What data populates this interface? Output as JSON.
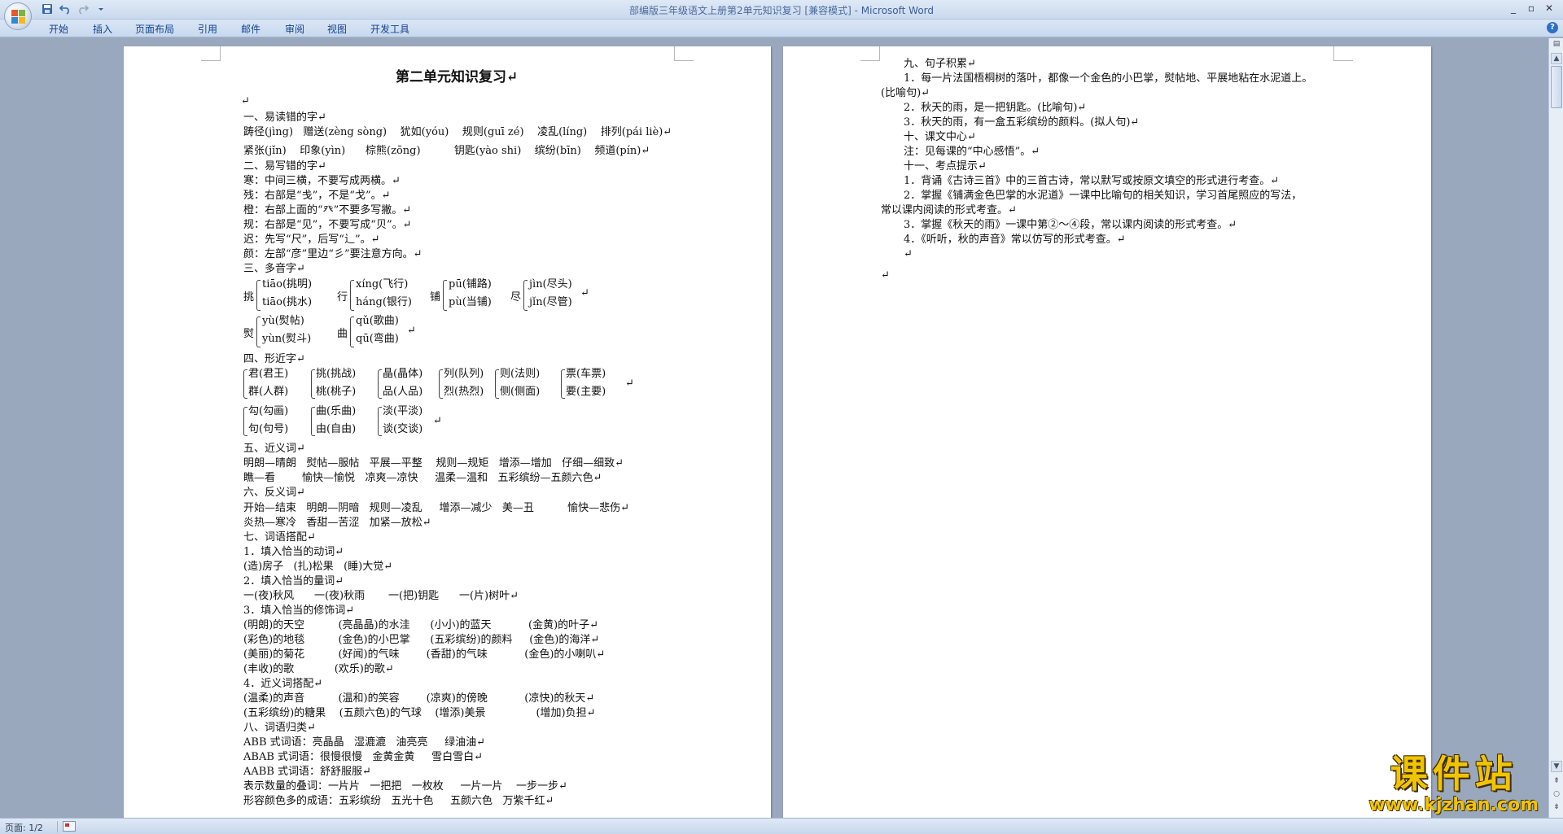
{
  "window": {
    "title": "部编版三年级语文上册第2单元知识复习 [兼容模式]",
    "title_sep": " - ",
    "app_name": "Microsoft Word",
    "minimize": "_",
    "restore": "▫",
    "close": "✕"
  },
  "quick_access": {
    "save_icon": "save-icon",
    "undo_icon": "undo-icon",
    "redo_icon": "redo-icon",
    "customize_icon": "dropdown-icon"
  },
  "ribbon_tabs": [
    "开始",
    "插入",
    "页面布局",
    "引用",
    "邮件",
    "审阅",
    "视图",
    "开发工具"
  ],
  "help": "?",
  "page1": {
    "lines": [
      "第二单元知识复习↵",
      "↵",
      "一、易读错的字↵",
      "踌径(jìng)   赠送(zèng sòng)    犹如(yóu)    规则(guī zé)    凌乱(líng)    排列(pái liè)↵",
      "紧张(jǐn)    印象(yìn)      棕熊(zōng)          钥匙(yào shi)    缤纷(bīn)    频道(pín)↵",
      "二、易写错的字↵",
      "寒：中间三横，不要写成两横。↵",
      "残：右部是“戋”，不是“戈”。↵",
      "橙：右部上面的“癶”不要多写撇。↵",
      "规：右部是“见”，不要写成“贝”。↵",
      "迟：先写“尺”，后写“辶”。↵",
      "颜：左部“彦”里边“彡”要注意方向。↵",
      "三、多音字↵",
      "挑",
      "tiāo(挑明)",
      "tiāo(挑水)",
      "行",
      "xíng(飞行)",
      "háng(银行)",
      "铺",
      "pū(铺路)",
      "pù(当铺)",
      "尽",
      "jìn(尽头)",
      "jǐn(尽管)",
      "↵",
      "熨",
      "yù(熨帖)",
      "yùn(熨斗)",
      "曲",
      "qǔ(歌曲)",
      "qū(弯曲)",
      "↵",
      "四、形近字↵",
      "君(君王)",
      "群(人群)",
      "挑(挑战)",
      "桃(桃子)",
      "晶(晶体)",
      "品(人品)",
      "列(队列)",
      "烈(热烈)",
      "则(法则)",
      "侧(侧面)",
      "票(车票)",
      "要(主要)",
      "↵",
      "勾(勾画)",
      "句(句号)",
      "曲(乐曲)",
      "由(自由)",
      "淡(平淡)",
      "谈(交谈)",
      "↵",
      "五、近义词↵",
      "明朗—晴朗   熨帖—服帖   平展—平整    规则—规矩   增添—增加   仔细—细致↵",
      "瞧—看        愉快—愉悦   凉爽—凉快     温柔—温和   五彩缤纷—五颜六色↵",
      "六、反义词↵",
      "开始—结束   明朗—阴暗   规则—凌乱     增添—减少   美—丑          愉快—悲伤↵",
      "炎热—寒冷   香甜—苦涩   加紧—放松↵",
      "七、词语搭配↵",
      "1．填入恰当的动词↵",
      "(造)房子   (扎)松果   (睡)大觉↵",
      "2．填入恰当的量词↵",
      "一(夜)秋风      一(夜)秋雨       一(把)钥匙      一(片)树叶↵",
      "3．填入恰当的修饰词↵",
      "(明朗)的天空          (亮晶晶)的水洼      (小小)的蓝天           (金黄)的叶子↵",
      "(彩色)的地毯          (金色)的小巴掌      (五彩缤纷)的颜料     (金色)的海洋↵",
      "(美丽)的菊花          (好闻)的气味        (香甜)的气味           (金色)的小喇叭↵",
      "(丰收)的歌            (欢乐)的歌↵",
      "4．近义词搭配↵",
      "(温柔)的声音          (温和)的笑容        (凉爽)的傍晚           (凉快)的秋天↵",
      "(五彩缤纷)的糖果    (五颜六色)的气球    (增添)美景               (增加)负担↵",
      "八、词语归类↵",
      "ABB 式词语：亮晶晶   湿漉漉   油亮亮     绿油油↵",
      "ABAB 式词语：很慢很慢   金黄金黄     雪白雪白↵",
      "AABB 式词语：舒舒服服↵",
      "表示数量的叠词：一片片   一把把   一枚枚     一片一片    一步一步↵",
      "形容颜色多的成语：五彩缤纷   五光十色     五颜六色   万紫千红↵"
    ]
  },
  "page2": {
    "lines": [
      "九、句子积累↵",
      "1．每一片法国梧桐树的落叶，都像一个金色的小巴掌，熨帖地、平展地粘在水泥道上。",
      "(比喻句)↵",
      "2．秋天的雨，是一把钥匙。(比喻句)↵",
      "3．秋天的雨，有一盒五彩缤纷的颜料。(拟人句)↵",
      "十、课文中心↵",
      "注：见每课的“中心感悟”。↵",
      "十一、考点提示↵",
      "1．背诵《古诗三首》中的三首古诗，常以默写或按原文填空的形式进行考查。↵",
      "2．掌握《铺满金色巴掌的水泥道》一课中比喻句的相关知识，学习首尾照应的写法，",
      "常以课内阅读的形式考查。↵",
      "3．掌握《秋天的雨》一课中第②～④段，常以课内阅读的形式考查。↵",
      "4．《听听，秋的声音》常以仿写的形式考查。↵",
      "↵",
      "↵"
    ]
  },
  "status": {
    "page_info": "页面: 1/2",
    "macro_icon": "macro-recording-icon"
  },
  "watermark": {
    "big": "课件站",
    "small": "www.kjzhan.com"
  },
  "colors": {
    "accent": "#15428b",
    "title_app": "#3b5e99",
    "doc_bg": "#9aa8bd",
    "watermark": "#f2c400"
  }
}
